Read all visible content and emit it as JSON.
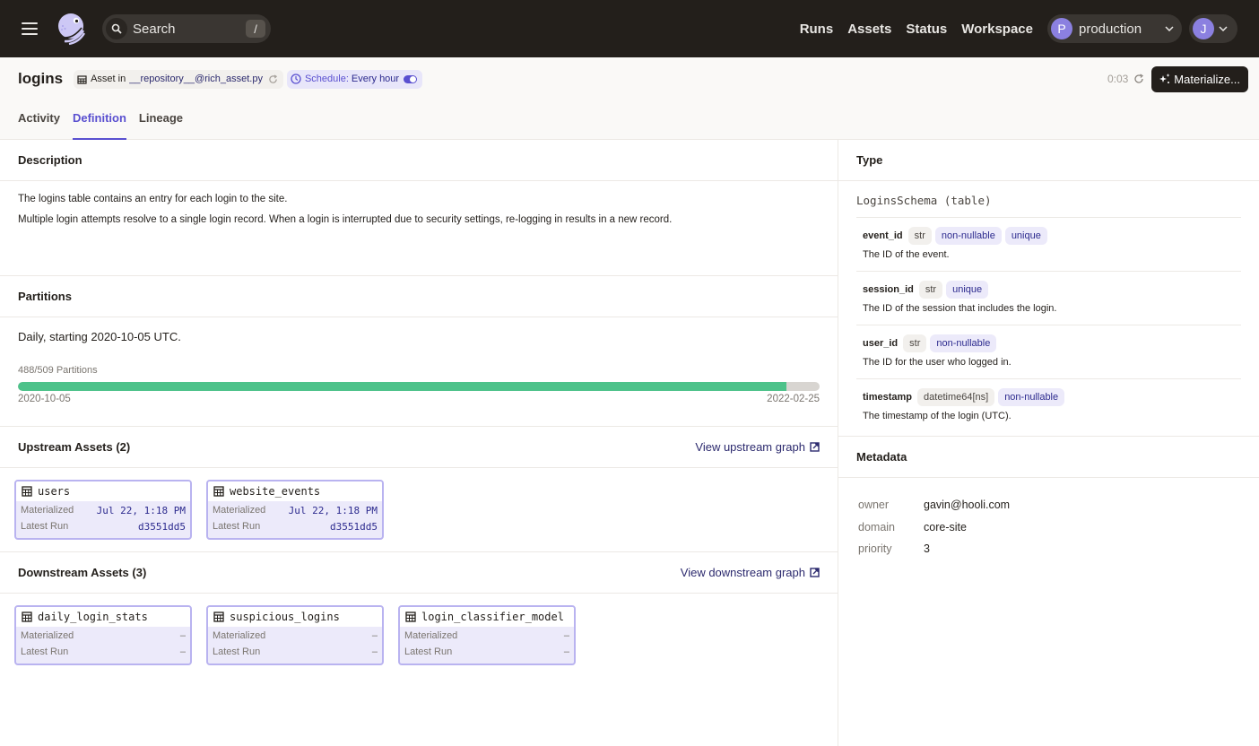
{
  "nav": {
    "search_placeholder": "Search",
    "search_shortcut": "/",
    "links": [
      "Runs",
      "Assets",
      "Status",
      "Workspace"
    ],
    "deployment": {
      "initial": "P",
      "name": "production"
    },
    "user": {
      "initial": "J"
    }
  },
  "header": {
    "title": "logins",
    "asset_in_label": "Asset in",
    "repository": "__repository__@rich_asset.py",
    "schedule_label": "Schedule:",
    "schedule_value": "Every hour",
    "schedule_enabled": true,
    "timer": "0:03",
    "materialize_label": "Materialize..."
  },
  "tabs": [
    {
      "label": "Activity",
      "active": false
    },
    {
      "label": "Definition",
      "active": true
    },
    {
      "label": "Lineage",
      "active": false
    }
  ],
  "description": {
    "title": "Description",
    "paragraphs": [
      "The logins table contains an entry for each login to the site.",
      "Multiple login attempts resolve to a single login record. When a login is interrupted due to security settings, re-logging in results in a new record."
    ]
  },
  "partitions": {
    "title": "Partitions",
    "description": "Daily, starting 2020-10-05 UTC.",
    "count_label": "488/509 Partitions",
    "materialized": 488,
    "total": 509,
    "start_date": "2020-10-05",
    "end_date": "2022-02-25"
  },
  "upstream": {
    "title": "Upstream Assets (2)",
    "link": "View upstream graph",
    "assets": [
      {
        "name": "users",
        "materialized_label": "Materialized",
        "materialized": "Jul 22, 1:18 PM",
        "run_label": "Latest Run",
        "run": "d3551dd5"
      },
      {
        "name": "website_events",
        "materialized_label": "Materialized",
        "materialized": "Jul 22, 1:18 PM",
        "run_label": "Latest Run",
        "run": "d3551dd5"
      }
    ]
  },
  "downstream": {
    "title": "Downstream Assets (3)",
    "link": "View downstream graph",
    "assets": [
      {
        "name": "daily_login_stats",
        "materialized_label": "Materialized",
        "materialized": "–",
        "run_label": "Latest Run",
        "run": "–"
      },
      {
        "name": "suspicious_logins",
        "materialized_label": "Materialized",
        "materialized": "–",
        "run_label": "Latest Run",
        "run": "–"
      },
      {
        "name": "login_classifier_model",
        "materialized_label": "Materialized",
        "materialized": "–",
        "run_label": "Latest Run",
        "run": "–"
      }
    ]
  },
  "type": {
    "title": "Type",
    "schema": "LoginsSchema (table)",
    "columns": [
      {
        "name": "event_id",
        "type": "str",
        "constraints": [
          "non-nullable",
          "unique"
        ],
        "description": "The ID of the event."
      },
      {
        "name": "session_id",
        "type": "str",
        "constraints": [
          "unique"
        ],
        "description": "The ID of the session that includes the login."
      },
      {
        "name": "user_id",
        "type": "str",
        "constraints": [
          "non-nullable"
        ],
        "description": "The ID for the user who logged in."
      },
      {
        "name": "timestamp",
        "type": "datetime64[ns]",
        "constraints": [
          "non-nullable"
        ],
        "description": "The timestamp of the login (UTC)."
      }
    ]
  },
  "metadata": {
    "title": "Metadata",
    "entries": [
      {
        "key": "owner",
        "value": "gavin@hooli.com"
      },
      {
        "key": "domain",
        "value": "core-site"
      },
      {
        "key": "priority",
        "value": "3"
      }
    ]
  },
  "colors": {
    "nav_bg": "#231f1b",
    "accent": "#5a50d0",
    "success": "#4dc28a",
    "link": "#2c2a6e"
  }
}
